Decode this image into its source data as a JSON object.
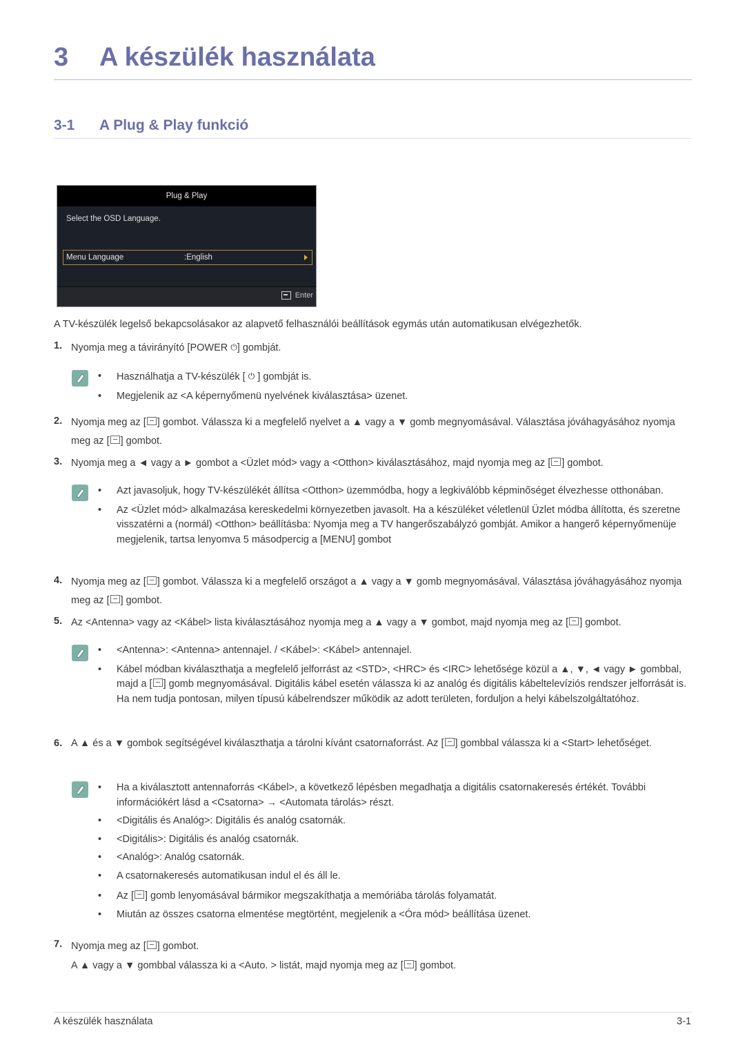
{
  "chapter": {
    "number": "3",
    "title": "A készülék használata"
  },
  "section": {
    "number": "3-1",
    "title": "A Plug & Play funkció"
  },
  "osd": {
    "title": "Plug & Play",
    "prompt": "Select the OSD Language.",
    "row_label": "Menu Language",
    "row_value": ":English",
    "footer_button": "Enter",
    "highlight_color": "#b08a3c",
    "arrow_color": "#f0a830"
  },
  "intro": "A TV-készülék legelső bekapcsolásakor az alapvető felhasználói beállítások egymás után automatikusan elvégezhetők.",
  "steps": [
    {
      "n": "1.",
      "parts": [
        "Nyomja meg a távirányító [POWER ",
        "] gombját."
      ]
    },
    {
      "n": "2.",
      "parts": [
        "Nyomja meg az [",
        "] gombot. Válassza ki a megfelelő nyelvet a ▲ vagy a ▼ gomb megnyomásával. Választása jóváhagyásához nyomja meg az [",
        "] gombot."
      ]
    },
    {
      "n": "3.",
      "parts": [
        "Nyomja meg a ◄ vagy a ► gombot a <Üzlet mód> vagy a <Otthon> kiválasztásához, majd nyomja meg az [",
        "] gombot."
      ]
    },
    {
      "n": "4.",
      "parts": [
        "Nyomja meg az [",
        "] gombot. Válassza ki a megfelelő országot a ▲ vagy a ▼ gomb megnyomásával. Választása jóváhagyásához nyomja meg az [",
        "] gombot."
      ]
    },
    {
      "n": "5.",
      "parts": [
        "Az <Antenna> vagy az <Kábel> lista kiválasztásához nyomja meg a ▲ vagy a ▼ gombot, majd nyomja meg az [",
        "] gombot."
      ]
    },
    {
      "n": "6.",
      "parts": [
        "A ▲ és a ▼ gombok segítségével kiválaszthatja a tárolni kívánt csatornaforrást. Az [",
        "] gombbal válassza ki a <Start> lehetőséget."
      ]
    },
    {
      "n": "7.",
      "parts": [
        "Nyomja meg az [",
        "] gombot."
      ],
      "line2": [
        "A ▲ vagy a ▼ gombbal válassza ki a <Auto. > listát, majd nyomja meg az [",
        "] gombot."
      ]
    }
  ],
  "notes": {
    "n1": [
      [
        "Használhatja a TV-készülék [ ",
        " ] gombját is."
      ],
      [
        "Megjelenik az <A képernyőmenü nyelvének kiválasztása> üzenet."
      ]
    ],
    "n3": [
      [
        "Azt javasoljuk, hogy TV-készülékét állítsa <Otthon> üzemmódba, hogy a legkiválóbb képminőséget élvezhesse otthonában."
      ],
      [
        "Az <Üzlet mód> alkalmazása kereskedelmi környezetben javasolt. Ha a készüléket véletlenül Üzlet módba állította, és szeretne visszatérni a (normál) <Otthon> beállításba: Nyomja meg a TV hangerőszabályzó gombját. Amikor a hangerő képernyőmenüje megjelenik, tartsa lenyomva 5 másodpercig a [MENU] gombot"
      ]
    ],
    "n5": [
      [
        "<Antenna>: <Antenna> antennajel. / <Kábel>: <Kábel> antennajel."
      ],
      [
        "Kábel módban kiválaszthatja a megfelelő jelforrást az <STD>, <HRC> és <IRC> lehetősége közül a ▲, ▼, ◄ vagy ► gombbal, majd a [",
        "] gomb megnyomásával. Digitális kábel esetén válassza ki az analóg és digitális kábeltelevíziós rendszer jelforrását is. Ha nem tudja pontosan, milyen típusú kábelrendszer működik az adott területen, forduljon a helyi kábelszolgáltatóhoz."
      ]
    ],
    "n6": [
      [
        "Ha a kiválasztott antennaforrás <Kábel>, a következő lépésben megadhatja a digitális csatornakeresés értékét. További információkért lásd a <Csatorna> → <Automata tárolás> részt."
      ],
      [
        "<Digitális és Analóg>: Digitális és analóg csatornák."
      ],
      [
        "<Digitális>: Digitális és analóg csatornák."
      ],
      [
        "<Analóg>: Analóg csatornák."
      ],
      [
        "A csatornakeresés automatikusan indul el és áll le."
      ],
      [
        "Az [",
        "] gomb lenyomásával bármikor megszakíthatja a memóriába tárolás folyamatát."
      ],
      [
        "Miután az összes csatorna elmentése megtörtént, megjelenik a <Óra mód> beállítása üzenet."
      ]
    ]
  },
  "icons": {
    "power": "⏻",
    "enter": "enter-icon",
    "note": "pencil-note-icon"
  },
  "footer": {
    "left": "A készülék használata",
    "right": "3-1"
  }
}
